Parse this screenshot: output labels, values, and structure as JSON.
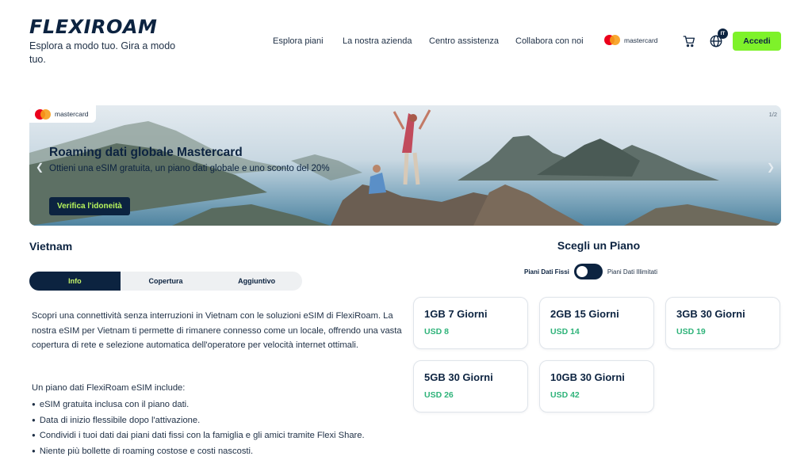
{
  "header": {
    "logo": "FLEXIROAM",
    "tagline": "Esplora a modo tuo. Gira a modo tuo.",
    "nav": [
      "Esplora piani",
      "La nostra azienda",
      "Centro assistenza",
      "Collabora con noi"
    ],
    "partner": "mastercard",
    "language": "IT",
    "login_label": "Accedi",
    "accent_color": "#7ef22a"
  },
  "banner": {
    "partner": "mastercard",
    "title": "Roaming dati globale Mastercard",
    "subtitle": "Ottieni una eSIM gratuita, un piano dati globale e uno sconto del 20%",
    "cta_label": "Verifica l'idoneità",
    "counter": "1/2"
  },
  "destination": {
    "country": "Vietnam",
    "tabs": [
      "Info",
      "Copertura",
      "Aggiuntivo"
    ],
    "active_tab": "Info",
    "description": "Scopri una connettività senza interruzioni in Vietnam con le soluzioni eSIM di FlexiRoam. La nostra eSIM per Vietnam ti permette di rimanere connesso come un locale, offrendo una vasta copertura di rete e selezione automatica dell'operatore per velocità internet ottimali.",
    "includes_title": "Un piano dati FlexiRoam eSIM include:",
    "includes": [
      "eSIM gratuita inclusa con il piano dati.",
      "Data di inizio flessibile dopo l'attivazione.",
      "Condividi i tuoi dati dai piani dati fissi con la famiglia e gli amici tramite Flexi Share.",
      "Niente più bollette di roaming costose e costi nascosti."
    ]
  },
  "plans": {
    "heading": "Scegli un Piano",
    "toggle_left": "Piani Dati Fissi",
    "toggle_right": "Piani Dati Illimitati",
    "items": [
      {
        "name": "1GB 7 Giorni",
        "price": "USD 8"
      },
      {
        "name": "2GB 15 Giorni",
        "price": "USD 14"
      },
      {
        "name": "3GB 30 Giorni",
        "price": "USD 19"
      },
      {
        "name": "5GB 30 Giorni",
        "price": "USD 26"
      },
      {
        "name": "10GB 30 Giorni",
        "price": "USD 42"
      }
    ],
    "price_color": "#2fb37a"
  },
  "icons": [
    "cart-icon",
    "globe-icon",
    "chevron-left-icon",
    "chevron-right-icon",
    "mastercard-logo"
  ]
}
